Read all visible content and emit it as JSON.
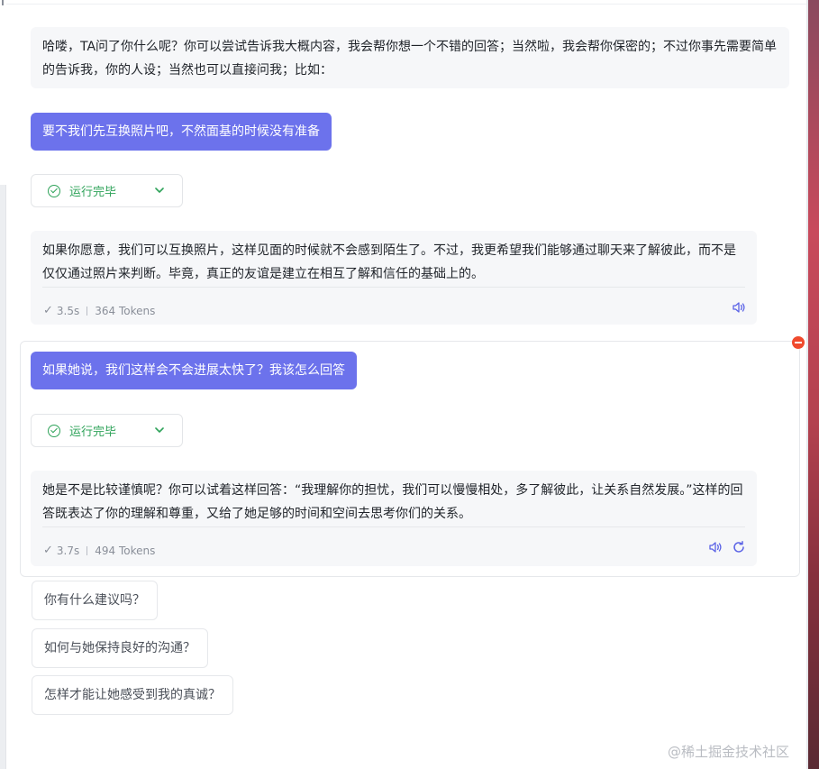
{
  "messages": {
    "intro": {
      "text": "哈喽，TA问了你什么呢？你可以尝试告诉我大概内容，我会帮你想一个不错的回答；当然啦，我会帮你保密的；不过你事先需要简单的告诉我，你的人设；当然也可以直接问我；比如："
    },
    "user_1": {
      "text": "要不我们先互换照片吧，不然面基的时候没有准备"
    },
    "status_1": {
      "label": "运行完毕",
      "icon": "check-circle-icon",
      "color": "#2fa35a"
    },
    "reply_1": {
      "text": "如果你愿意，我们可以互换照片，这样见面的时候就不会感到陌生了。不过，我更希望我们能够通过聊天来了解彼此，而不是仅仅通过照片来判断。毕竟，真正的友谊是建立在相互了解和信任的基础上的。",
      "duration": "3.5s",
      "tokens": "364 Tokens"
    },
    "user_2": {
      "text": "如果她说，我们这样会不会进展太快了？我该怎么回答"
    },
    "status_2": {
      "label": "运行完毕",
      "icon": "check-circle-icon",
      "color": "#2fa35a"
    },
    "reply_2": {
      "text": "她是不是比较谨慎呢？你可以试着这样回答：“我理解你的担忧，我们可以慢慢相处，多了解彼此，让关系自然发展。”这样的回答既表达了你的理解和尊重，又给了她足够的时间和空间去思考你们的关系。",
      "duration": "3.7s",
      "tokens": "494 Tokens"
    }
  },
  "suggestions": [
    "你有什么建议吗？",
    "如何与她保持良好的沟通？",
    "怎样才能让她感受到我的真诚？"
  ],
  "watermark": "@稀土掘金技术社区",
  "colors": {
    "user_bubble": "#6c72ec",
    "ai_bubble": "#f6f7f9",
    "success": "#2fa35a",
    "icon_accent": "#5b63e6",
    "remove": "#f04a2d"
  }
}
